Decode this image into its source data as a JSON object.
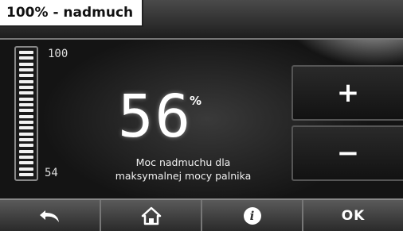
{
  "header": {
    "title": "100% - nadmuch"
  },
  "level_bar": {
    "max_label": "100",
    "min_label": "54",
    "value": 56,
    "min": 54,
    "max": 100
  },
  "main": {
    "value": "56",
    "unit": "%",
    "description_line1": "Moc nadmuchu dla",
    "description_line2": "maksymalnej mocy palnika"
  },
  "controls": {
    "plus_label": "+",
    "minus_label": "−"
  },
  "footer": {
    "back_icon": "undo-arrow-icon",
    "home_icon": "home-icon",
    "info_icon": "info-icon",
    "info_label": "i",
    "ok_label": "OK"
  },
  "colors": {
    "background": "#0c0c0c",
    "text": "#ffffff",
    "footer": "#4a4a4a"
  }
}
